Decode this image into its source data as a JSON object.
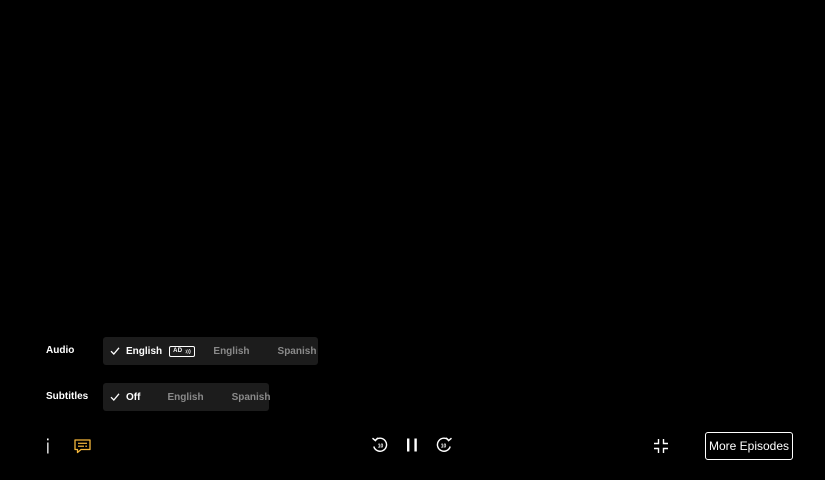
{
  "audio": {
    "label": "Audio",
    "options": [
      {
        "label": "English",
        "selected": true,
        "badge": "AD"
      },
      {
        "label": "English",
        "selected": false
      },
      {
        "label": "Spanish",
        "selected": false
      }
    ]
  },
  "subtitles": {
    "label": "Subtitles",
    "options": [
      {
        "label": "Off",
        "selected": true
      },
      {
        "label": "English",
        "selected": false
      },
      {
        "label": "Spanish",
        "selected": false
      }
    ]
  },
  "controls": {
    "info_icon": "info-icon",
    "subtitles_icon": "subtitles-icon",
    "rewind_icon": "rewind-10-icon",
    "rewind_seconds": "10",
    "pause_icon": "pause-icon",
    "forward_icon": "forward-10-icon",
    "forward_seconds": "10",
    "minimize_icon": "minimize-icon",
    "more_episodes_label": "More Episodes"
  },
  "colors": {
    "background": "#000000",
    "track_group_bg": "#1c1c1c",
    "inactive_text": "#8a8a8a",
    "accent": "#f5b73b"
  }
}
